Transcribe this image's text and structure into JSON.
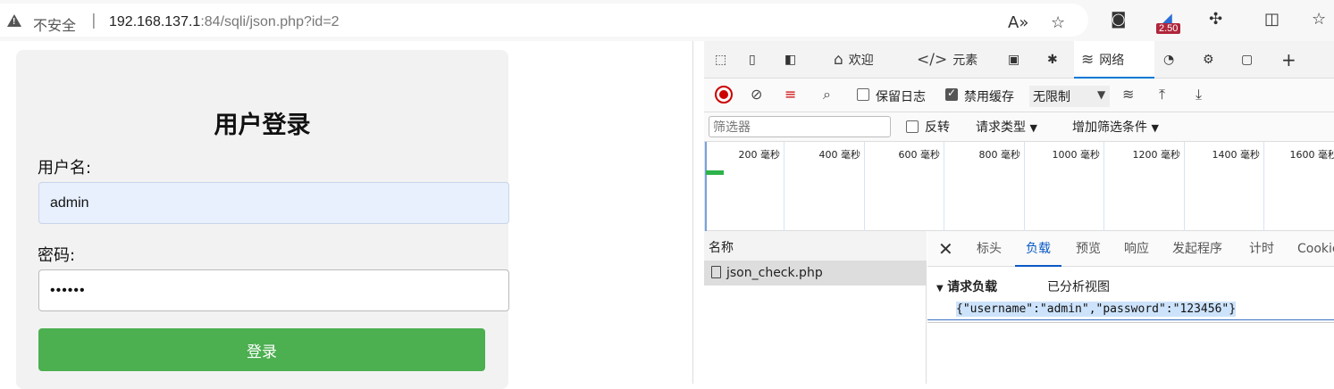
{
  "browser": {
    "security_text": "不安全",
    "separator": "|",
    "url_host": "192.168.137.1",
    "url_rest": ":84/sqli/json.php?id=2",
    "badge": "2.50"
  },
  "form": {
    "title": "用户登录",
    "username_label": "用户名:",
    "username_value": "admin",
    "password_label": "密码:",
    "password_value": "••••••",
    "login_button": "登录"
  },
  "devtools": {
    "tabs": [
      "欢迎",
      "元素",
      "网络"
    ],
    "toolbar": {
      "preserve_log": "保留日志",
      "disable_cache": "禁用缓存",
      "throttle": "无限制"
    },
    "filter": {
      "placeholder": "筛选器",
      "invert": "反转",
      "request_type": "请求类型",
      "add_filter": "增加筛选条件"
    },
    "timeline_ticks": [
      "200 毫秒",
      "400 毫秒",
      "600 毫秒",
      "800 毫秒",
      "1000 毫秒",
      "1200 毫秒",
      "1400 毫秒",
      "1600 毫秒"
    ],
    "name_header": "名称",
    "request_name": "json_check.php",
    "detail_tabs": [
      "标头",
      "负载",
      "预览",
      "响应",
      "发起程序",
      "计时",
      "Cookie"
    ],
    "payload_header": "请求负载",
    "parsed_view": "已分析视图",
    "payload": "{\"username\":\"admin\",\"password\":\"123456\"}"
  }
}
